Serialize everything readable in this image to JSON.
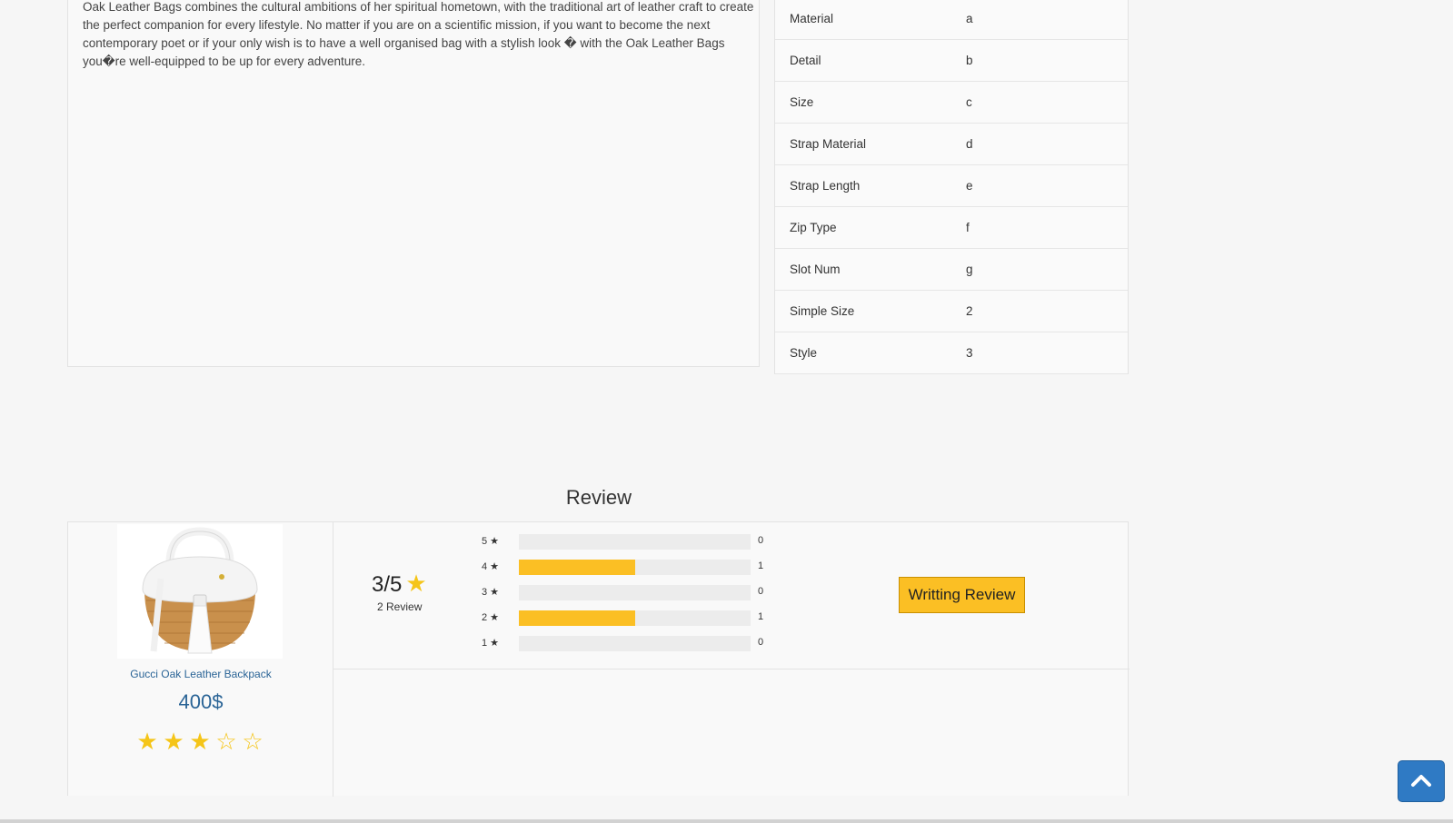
{
  "description": {
    "text": "Oak Leather Bags combines the cultural ambitions of her spiritual hometown, with the traditional art of leather craft to create the perfect companion for every lifestyle. No matter if you are on a scientific mission, if you want to become the next contemporary poet or if your only wish is to have a well organised bag with a stylish look � with the Oak Leather Bags you�re well-equipped to be up for every adventure."
  },
  "specs": [
    {
      "key": "Material",
      "value": "a"
    },
    {
      "key": "Detail",
      "value": "b"
    },
    {
      "key": "Size",
      "value": "c"
    },
    {
      "key": "Strap Material",
      "value": "d"
    },
    {
      "key": "Strap Length",
      "value": "e"
    },
    {
      "key": "Zip Type",
      "value": "f"
    },
    {
      "key": "Slot Num",
      "value": "g"
    },
    {
      "key": "Simple Size",
      "value": "2"
    },
    {
      "key": "Style",
      "value": "3"
    }
  ],
  "review": {
    "title": "Review",
    "product": {
      "name": "Gucci Oak Leather Backpack",
      "price": "400$",
      "rating": 3,
      "rating_max": 5
    },
    "average": "3/5",
    "count_label": "2 Review",
    "distribution": [
      {
        "stars": "5",
        "count": "0",
        "fraction": 0
      },
      {
        "stars": "4",
        "count": "1",
        "fraction": 0.5
      },
      {
        "stars": "3",
        "count": "0",
        "fraction": 0
      },
      {
        "stars": "2",
        "count": "1",
        "fraction": 0.5
      },
      {
        "stars": "1",
        "count": "0",
        "fraction": 0
      }
    ],
    "write_button": "Writting Review"
  },
  "colors": {
    "accent": "#fbbf24",
    "link": "#2a6496",
    "scroll_button": "#2f7ac4"
  },
  "icons": {
    "star": "star-icon",
    "scroll_top": "chevron-up-icon"
  }
}
